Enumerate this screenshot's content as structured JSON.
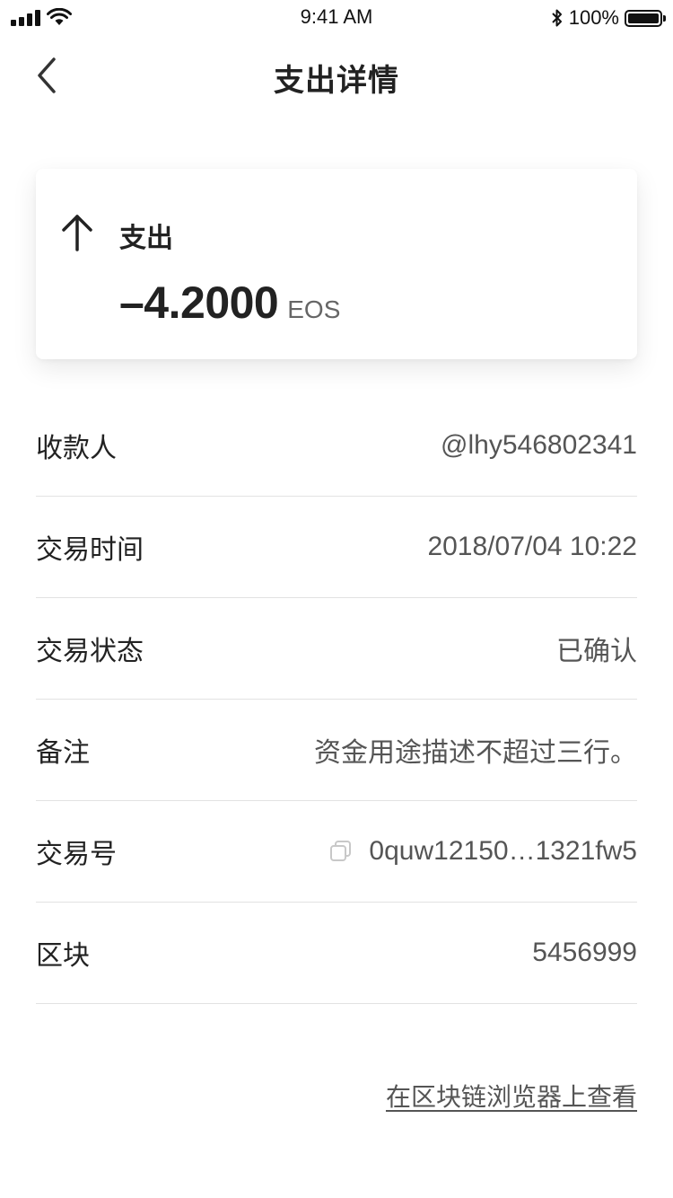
{
  "status_bar": {
    "time": "9:41 AM",
    "battery_percent": "100%",
    "battery_level": 1.0,
    "icons": [
      "signal-icon",
      "wifi-icon",
      "bluetooth-icon",
      "battery-icon"
    ]
  },
  "nav": {
    "title": "支出详情",
    "back_icon": "chevron-left-icon"
  },
  "summary": {
    "icon": "arrow-up-icon",
    "type_label": "支出",
    "amount": "–4.2000",
    "unit": "EOS"
  },
  "details": {
    "rows": [
      {
        "label": "收款人",
        "value": "@lhy546802341"
      },
      {
        "label": "交易时间",
        "value": "2018/07/04 10:22"
      },
      {
        "label": "交易状态",
        "value": "已确认"
      },
      {
        "label": "备注",
        "value": "资金用途描述不超过三行。"
      },
      {
        "label": "交易号",
        "value": "0quw12150…1321fw5",
        "icon": "copy-icon"
      },
      {
        "label": "区块",
        "value": "5456999"
      }
    ]
  },
  "footer": {
    "explorer_link": "在区块链浏览器上查看"
  },
  "colors": {
    "text_primary": "#222222",
    "text_secondary": "#555555",
    "divider": "#e2e2e2",
    "background": "#ffffff"
  }
}
